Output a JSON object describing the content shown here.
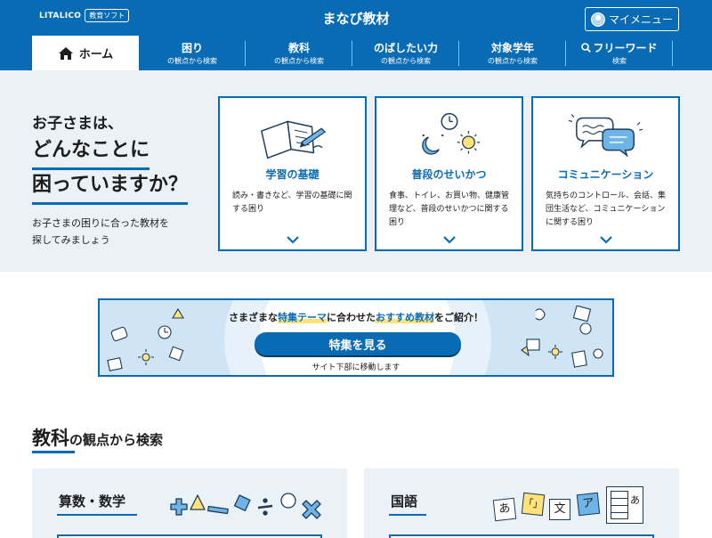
{
  "header": {
    "logo_main": "LITALICO",
    "logo_sub": "教育ソフト",
    "site_title": "まなび教材",
    "mymenu_label": "マイメニュー"
  },
  "nav": {
    "home_label": "ホーム",
    "items": [
      {
        "label": "困り",
        "sub": "の観点から検索"
      },
      {
        "label": "教科",
        "sub": "の観点から検索"
      },
      {
        "label": "のばしたい力",
        "sub": "の観点から検索"
      },
      {
        "label": "対象学年",
        "sub": "の観点から検索"
      },
      {
        "label": "フリーワード",
        "sub": "検索"
      }
    ]
  },
  "hero": {
    "line1": "お子さまは、",
    "line2": "どんなことに",
    "line3": "困っていますか？",
    "desc1": "お子さまの困りに合った教材を",
    "desc2": "探してみましょう"
  },
  "cards": [
    {
      "title": "学習の基礎",
      "desc": "読み・書きなど、学習の基礎に関する困り",
      "icon": "book-pencil-icon"
    },
    {
      "title": "普段のせいかつ",
      "desc": "食事、トイレ、お買い物、健康管理など、普段のせいかつに関する困り",
      "icon": "clock-moon-sun-icon"
    },
    {
      "title": "コミュニケーション",
      "desc": "気持ちのコントロール、会話、集団生活など、コミュニケーションに関する困り",
      "icon": "speech-bubbles-icon"
    }
  ],
  "banner": {
    "pre": "さまざまな",
    "highlight1": "特集テーマ",
    "mid": "に合わせた",
    "highlight2": "おすすめ教材",
    "post": "をご紹介！",
    "button_label": "特集を見る",
    "note": "サイト下部に移動します"
  },
  "subject_section": {
    "title_main": "教科",
    "title_rest": "の観点から検索",
    "subjects": [
      {
        "title": "算数・数学",
        "icon": "math-symbols-icon"
      },
      {
        "title": "国語",
        "icon": "kana-cards-icon",
        "kana": [
          "あ",
          "「」",
          "文",
          "ア",
          "あ"
        ]
      }
    ]
  },
  "colors": {
    "primary": "#0a6bb5",
    "hero_bg": "#eaf2f8",
    "banner_bg": "#cfe5f5",
    "highlight": "#ffe27a"
  }
}
